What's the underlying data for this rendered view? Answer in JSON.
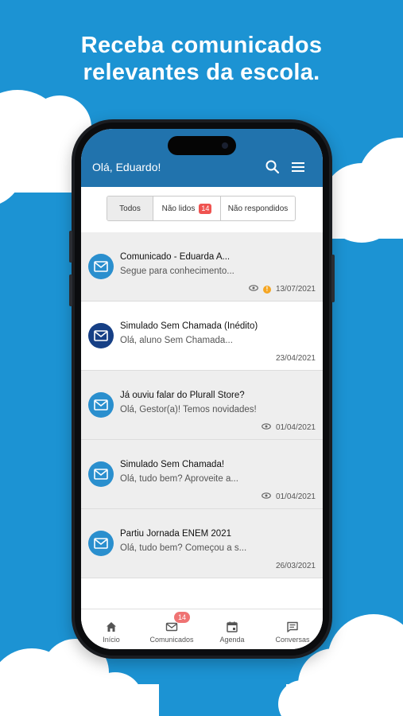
{
  "headline": {
    "line1": "Receba comunicados",
    "line2": "relevantes da escola."
  },
  "appbar": {
    "greeting": "Olá, Eduardo!",
    "search_icon": "search-icon",
    "menu_icon": "hamburger-menu-icon",
    "color": "#2173ad"
  },
  "filters": {
    "all": "Todos",
    "unread": "Não lidos",
    "unread_count": "14",
    "unanswered": "Não respondidos",
    "active": "Todos"
  },
  "messages": [
    {
      "title": "Comunicado - Eduarda A...",
      "preview": "Segue para conhecimento...",
      "date": "13/07/2021",
      "read": true,
      "seen_icon": true,
      "alert_icon": true
    },
    {
      "title": "Simulado Sem Chamada (Inédito)",
      "preview": "Olá, aluno Sem Chamada...",
      "date": "23/04/2021",
      "read": false,
      "seen_icon": false,
      "alert_icon": false
    },
    {
      "title": "Já ouviu falar do Plurall Store?",
      "preview": "Olá, Gestor(a)! Temos novidades!",
      "date": "01/04/2021",
      "read": true,
      "seen_icon": true,
      "alert_icon": false
    },
    {
      "title": "Simulado Sem Chamada!",
      "preview": "Olá, tudo bem? Aproveite a...",
      "date": "01/04/2021",
      "read": true,
      "seen_icon": true,
      "alert_icon": false
    },
    {
      "title": "Partiu Jornada ENEM 2021",
      "preview": "Olá, tudo bem? Começou a s...",
      "date": "26/03/2021",
      "read": true,
      "seen_icon": false,
      "alert_icon": false
    }
  ],
  "bottom_nav": {
    "home": "Início",
    "messages": "Comunicados",
    "messages_badge": "14",
    "agenda": "Agenda",
    "chats": "Conversas"
  },
  "colors": {
    "background": "#1c93d3",
    "unread_avatar": "#163f85",
    "read_avatar": "#2a8fce",
    "badge": "#ef5350"
  }
}
